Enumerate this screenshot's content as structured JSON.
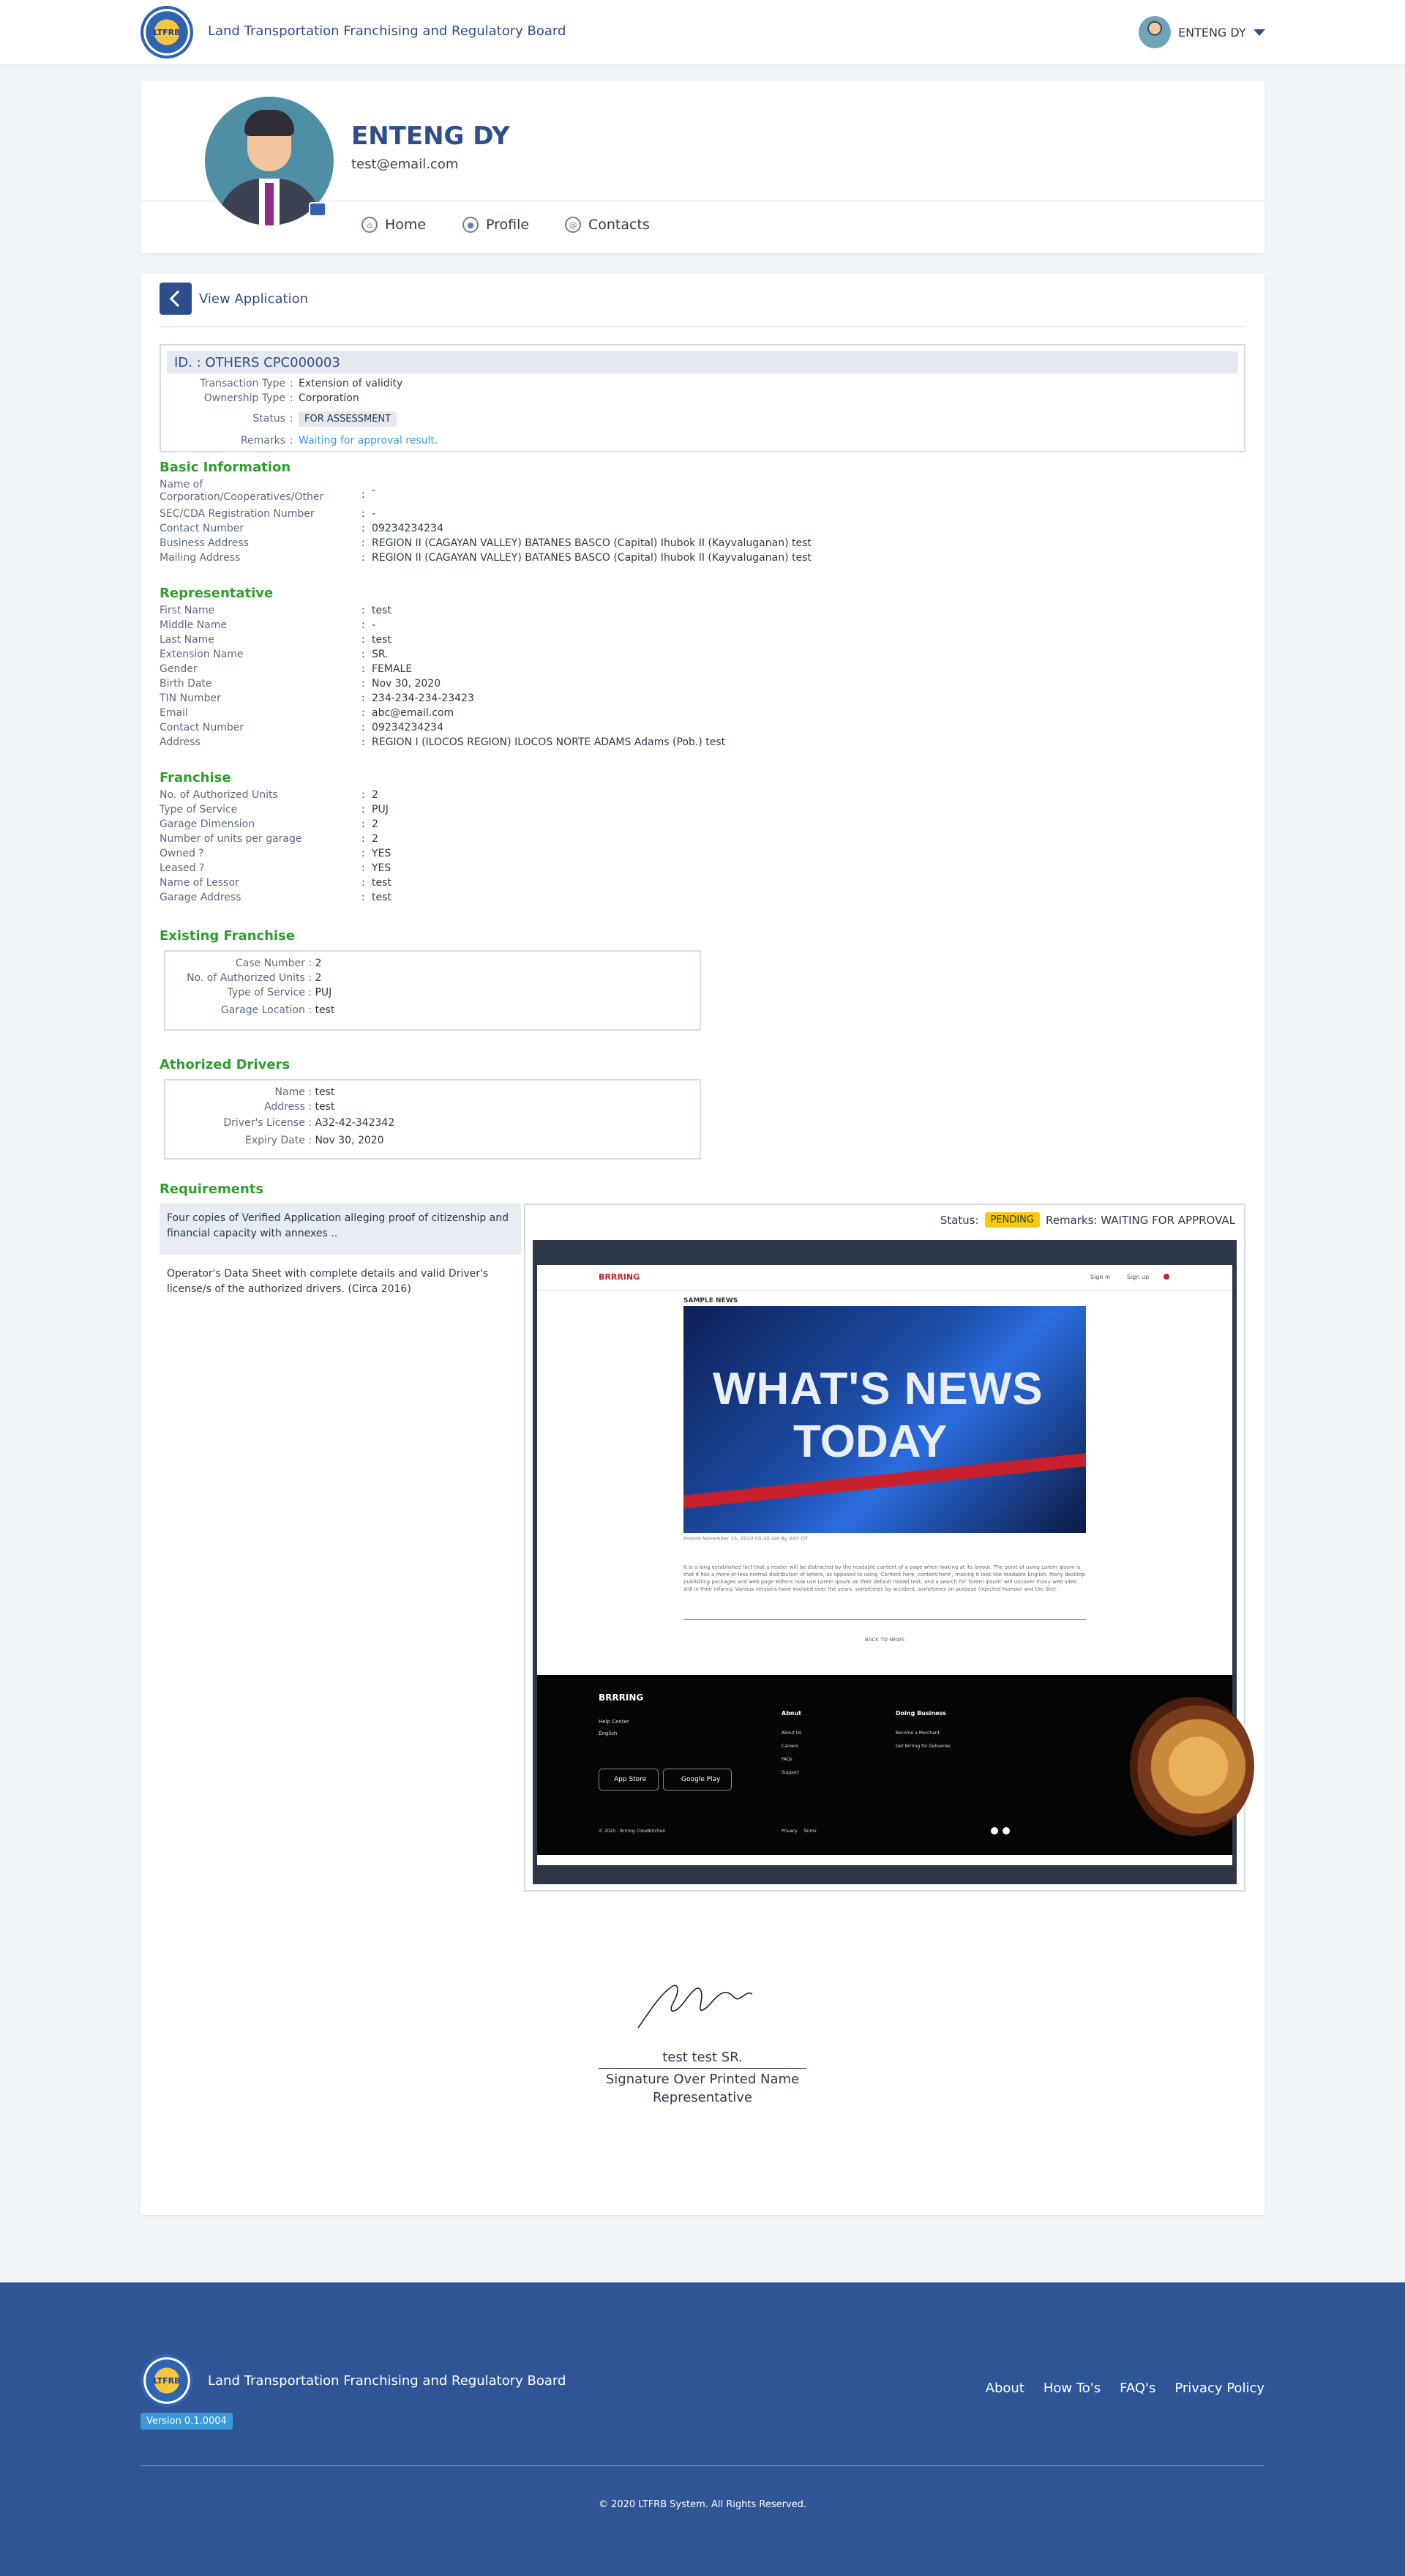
{
  "header": {
    "logo_text": "LTFRB",
    "agency": "Land Transportation Franchising and Regulatory Board",
    "user_name": "ENTENG DY"
  },
  "profile": {
    "name": "ENTENG DY",
    "email": "test@email.com",
    "nav": [
      "Home",
      "Profile",
      "Contacts"
    ]
  },
  "application": {
    "back_label": "View Application",
    "id_label": "ID. : OTHERS CPC000003",
    "transaction_type_label": "Transaction Type",
    "transaction_type": "Extension of validity",
    "ownership_type_label": "Ownership Type",
    "ownership_type": "Corporation",
    "status_label": "Status",
    "status": "FOR ASSESSMENT",
    "remarks_label": "Remarks",
    "remarks": "Waiting for approval result."
  },
  "basic_info": {
    "title": "Basic Information",
    "rows": [
      {
        "k": "Name of Corporation/Cooperatives/Other",
        "v": "-"
      },
      {
        "k": "SEC/CDA Registration Number",
        "v": "-"
      },
      {
        "k": "Contact Number",
        "v": "09234234234"
      },
      {
        "k": "Business Address",
        "v": "REGION II (CAGAYAN VALLEY) BATANES BASCO (Capital) Ihubok II (Kayvaluganan) test"
      },
      {
        "k": "Mailing Address",
        "v": "REGION II (CAGAYAN VALLEY) BATANES BASCO (Capital) Ihubok II (Kayvaluganan) test"
      }
    ]
  },
  "representative": {
    "title": "Representative",
    "rows": [
      {
        "k": "First Name",
        "v": "test"
      },
      {
        "k": "Middle Name",
        "v": "-"
      },
      {
        "k": "Last Name",
        "v": "test"
      },
      {
        "k": "Extension Name",
        "v": "SR."
      },
      {
        "k": "Gender",
        "v": "FEMALE"
      },
      {
        "k": "Birth Date",
        "v": "Nov 30, 2020"
      },
      {
        "k": "TIN Number",
        "v": "234-234-234-23423"
      },
      {
        "k": "Email",
        "v": "abc@email.com"
      },
      {
        "k": "Contact Number",
        "v": "09234234234"
      },
      {
        "k": "Address",
        "v": "REGION I (ILOCOS REGION) ILOCOS NORTE ADAMS Adams (Pob.) test"
      }
    ]
  },
  "franchise": {
    "title": "Franchise",
    "rows": [
      {
        "k": "No. of Authorized Units",
        "v": "2"
      },
      {
        "k": "Type of Service",
        "v": "PUJ"
      },
      {
        "k": "Garage Dimension",
        "v": "2"
      },
      {
        "k": "Number of units per garage",
        "v": "2"
      },
      {
        "k": "Owned ?",
        "v": "YES"
      },
      {
        "k": "Leased ?",
        "v": "YES"
      },
      {
        "k": "Name of Lessor",
        "v": "test"
      },
      {
        "k": "Garage Address",
        "v": "test"
      }
    ]
  },
  "existing_franchise": {
    "title": "Existing Franchise",
    "rows": [
      {
        "k": "Case Number :",
        "v": "2"
      },
      {
        "k": "No. of Authorized Units :",
        "v": "2"
      },
      {
        "k": "Type of Service :",
        "v": "PUJ"
      },
      {
        "k": "Garage Location :",
        "v": "test"
      }
    ]
  },
  "drivers": {
    "title": "Athorized Drivers",
    "rows": [
      {
        "k": "Name :",
        "v": "test"
      },
      {
        "k": "Address :",
        "v": "test"
      },
      {
        "k": "Driver's License :",
        "v": "A32-42-342342"
      },
      {
        "k": "Expiry Date :",
        "v": "Nov 30, 2020"
      }
    ]
  },
  "requirements": {
    "title": "Requirements",
    "items": [
      "Four copies of Verified Application alleging proof of citizenship and financial capacity with annexes ..",
      "Operator's Data Sheet with complete details and valid Driver's license/s of the authorized drivers. (Circa 2016)"
    ],
    "status_label": "Status:",
    "status_value": "PENDING",
    "remarks": "Remarks: WAITING FOR APPROVAL",
    "preview": {
      "brand": "BRRRING",
      "nav": [
        "Sign in",
        "Sign up"
      ],
      "section": "SAMPLE NEWS",
      "headline_1": "WHAT'S NEWS",
      "headline_2": "TODAY",
      "posted": "Posted November 15, 2020 00:30 AM By ANY DY",
      "body": "It is a long established fact that a reader will be distracted by the readable content of a page when looking at its layout. The point of using Lorem Ipsum is that it has a more-or-less normal distribution of letters, as opposed to using 'Content here, content here', making it look like readable English. Many desktop publishing packages and web page editors now use Lorem Ipsum as their default model text, and a search for 'lorem ipsum' will uncover many web sites still in their infancy. Various versions have evolved over the years, sometimes by accident, sometimes on purpose (injected humour and the like).",
      "back": "BACK TO NEWS",
      "footer_brand": "BRRRING",
      "footer_left": [
        "Help Center",
        "English"
      ],
      "about_title": "About",
      "about_links": [
        "About Us",
        "Careers",
        "FAQs",
        "Support"
      ],
      "biz_title": "Doing Business",
      "biz_links": [
        "Become a Merchant",
        "Get Brrring for Deliveries"
      ],
      "app_store": "App Store",
      "google_play": "Google Play",
      "copyright": "© 2020 - Brrring CloudKitchen",
      "legal": [
        "Privacy",
        "Terms"
      ]
    }
  },
  "signature": {
    "name": "test test SR.",
    "line1": "Signature Over Printed Name",
    "line2": "Representative"
  },
  "footer": {
    "agency": "Land Transportation Franchising and Regulatory Board",
    "version": "Version 0.1.0004",
    "links": [
      "About",
      "How To's",
      "FAQ's",
      "Privacy Policy"
    ],
    "copyright": "© 2020 LTFRB System. All Rights Reserved."
  }
}
